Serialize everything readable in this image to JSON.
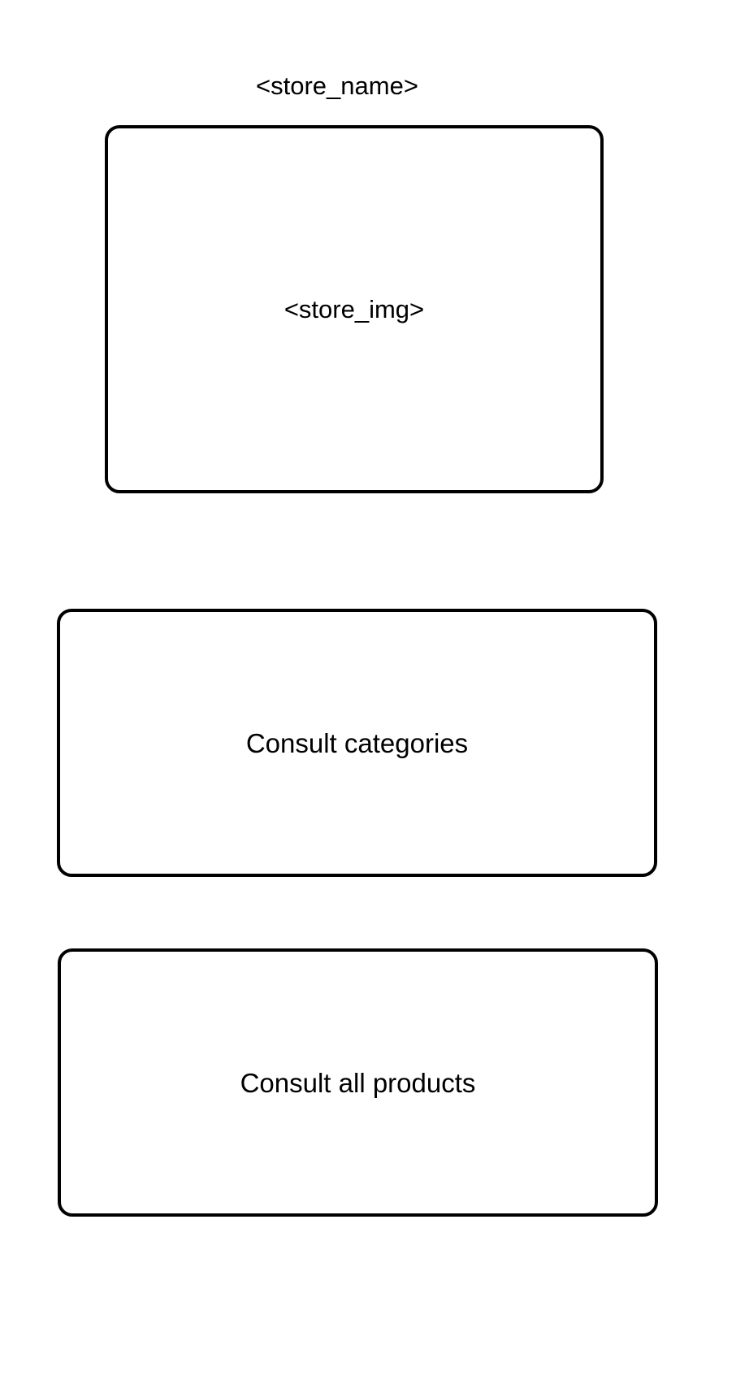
{
  "header": {
    "store_name": "<store_name>"
  },
  "hero": {
    "store_image_placeholder": "<store_img>"
  },
  "actions": {
    "consult_categories_label": "Consult categories",
    "consult_all_products_label": "Consult all products"
  },
  "colors": {
    "background": "#ffffff",
    "border": "#000000",
    "text": "#000000"
  }
}
